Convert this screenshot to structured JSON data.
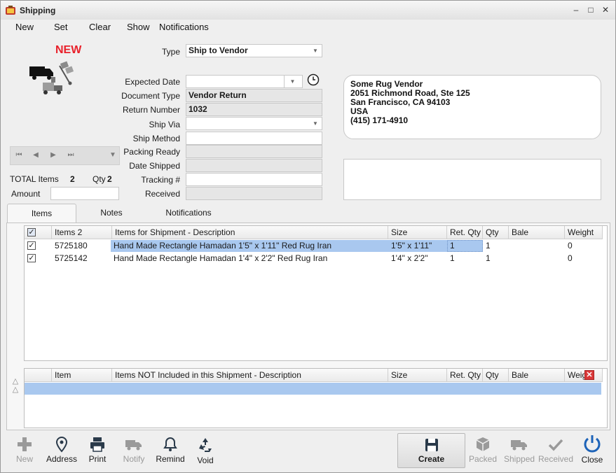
{
  "window": {
    "title": "Shipping",
    "controls": {
      "minimize": "–",
      "maximize": "□",
      "close": "✕"
    }
  },
  "menu": [
    "New",
    "Set",
    "Clear",
    "Show",
    "Notifications"
  ],
  "status_label": "NEW",
  "status_color": "#e8202a",
  "summary": {
    "total_items_label": "TOTAL Items",
    "total_items_value": "2",
    "qty_label": "Qty",
    "qty_value": "2",
    "amount_label": "Amount",
    "amount_value": ""
  },
  "form": {
    "type": {
      "label": "Type",
      "value": "Ship to Vendor"
    },
    "expected_date": {
      "label": "Expected Date",
      "value": ""
    },
    "document_type": {
      "label": "Document Type",
      "value": "Vendor Return"
    },
    "return_number": {
      "label": "Return Number",
      "value": "1032"
    },
    "ship_via": {
      "label": "Ship Via",
      "value": ""
    },
    "ship_method": {
      "label": "Ship Method",
      "value": ""
    },
    "packing_ready": {
      "label": "Packing Ready",
      "value": ""
    },
    "date_shipped": {
      "label": "Date Shipped",
      "value": ""
    },
    "tracking": {
      "label": "Tracking #",
      "value": ""
    },
    "received": {
      "label": "Received",
      "value": ""
    }
  },
  "address": [
    "Some Rug Vendor",
    "2051 Richmond Road, Ste 125",
    "San Francisco, CA 94103",
    "USA",
    "(415) 171-4910"
  ],
  "tabs": [
    "Items",
    "Notes",
    "Notifications"
  ],
  "items_grid": {
    "columns": [
      "Items 2",
      "Items for Shipment - Description",
      "Size",
      "Ret. Qty",
      "Qty",
      "Bale",
      "Weight"
    ],
    "rows": [
      {
        "checked": true,
        "item": "5725180",
        "description": "Hand Made Rectangle Hamadan 1'5\" x 1'11\" Red Rug Iran",
        "size": "1'5\" x 1'11\"",
        "ret_qty": "1",
        "qty": "1",
        "bale": "",
        "weight": "0"
      },
      {
        "checked": true,
        "item": "5725142",
        "description": "Hand Made Rectangle Hamadan 1'4\" x 2'2\" Red Rug Iran",
        "size": "1'4\" x 2'2\"",
        "ret_qty": "1",
        "qty": "1",
        "bale": "",
        "weight": "0"
      }
    ]
  },
  "excluded_grid": {
    "columns": [
      "Item",
      "Items NOT Included in this Shipment - Description",
      "Size",
      "Ret. Qty",
      "Qty",
      "Bale",
      "Weig"
    ]
  },
  "toolbar": {
    "new": "New",
    "address": "Address",
    "print": "Print",
    "notify": "Notify",
    "remind": "Remind",
    "void": "Void",
    "create": "Create",
    "packed": "Packed",
    "shipped": "Shipped",
    "received": "Received",
    "close": "Close"
  },
  "colors": {
    "selection": "#a9c8ef",
    "accent_blue": "#1d63b8",
    "disabled": "#9a9a9a"
  }
}
